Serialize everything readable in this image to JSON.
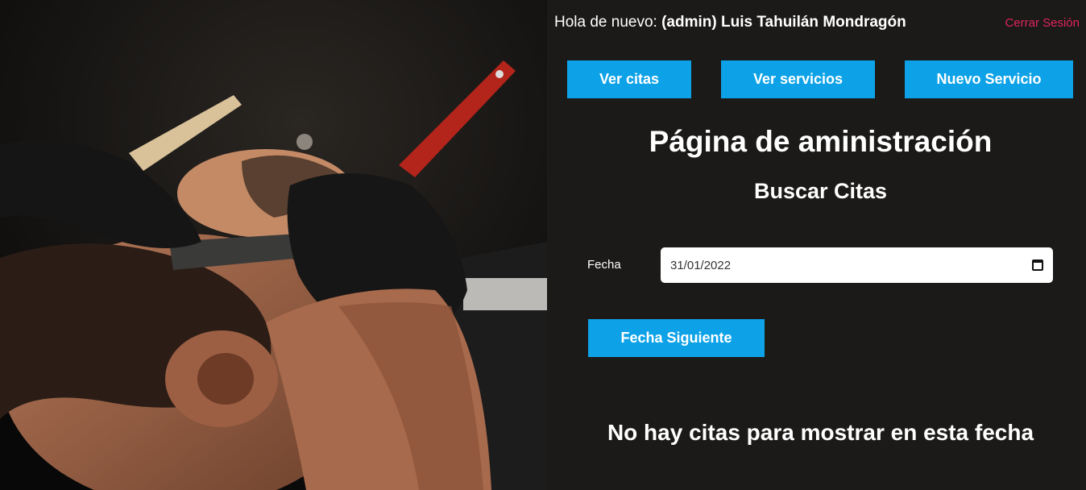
{
  "header": {
    "greeting_prefix": "Hola de nuevo:",
    "user_name": "(admin) Luis Tahuilán Mondragón",
    "logout_label": "Cerrar Sesión"
  },
  "nav": {
    "ver_citas": "Ver citas",
    "ver_servicios": "Ver servicios",
    "nuevo_servicio": "Nuevo Servicio"
  },
  "main": {
    "title": "Página de aministración",
    "subtitle": "Buscar Citas",
    "date_label": "Fecha",
    "date_value": "31/01/2022",
    "next_date_label": "Fecha Siguiente",
    "empty_message": "No hay citas para mostrar en esta fecha"
  },
  "colors": {
    "accent": "#0da2e7",
    "logout": "#e0245e",
    "background": "#1b1a18"
  },
  "icons": {
    "date_picker": "calendar-icon"
  }
}
